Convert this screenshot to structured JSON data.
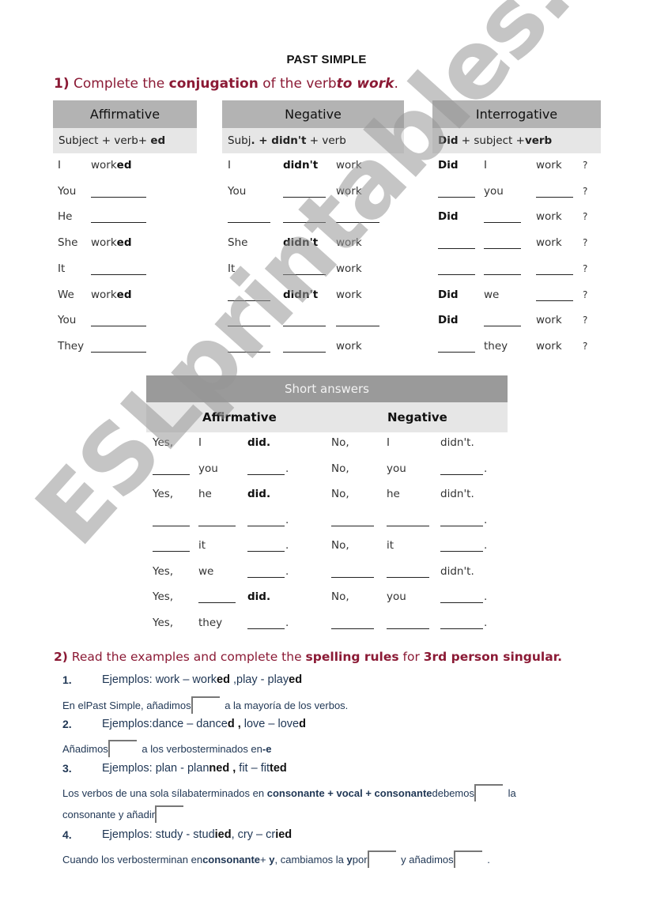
{
  "title": "PAST SIMPLE",
  "exercise1": {
    "number": "1)",
    "pre": "Complete the ",
    "bold": "conjugation",
    "mid": " of the verb",
    "italic": "to work",
    "end": "."
  },
  "tables": {
    "affirmative": {
      "header": "Affirmative",
      "formula_plain": "Subject + verb+ ",
      "formula_bold": "ed",
      "rows": [
        {
          "subject": "I",
          "stem": "work",
          "suffix": "ed",
          "blank": false
        },
        {
          "subject": "You",
          "blank": true
        },
        {
          "subject": "He",
          "blank": true
        },
        {
          "subject": "She",
          "stem": "work",
          "suffix": "ed",
          "blank": false
        },
        {
          "subject": "It",
          "blank": true
        },
        {
          "subject": "We",
          "stem": "work",
          "suffix": "ed",
          "blank": false
        },
        {
          "subject": "You",
          "blank": true
        },
        {
          "subject": "They",
          "blank": true
        }
      ]
    },
    "negative": {
      "header": "Negative",
      "formula_a": "Subj",
      "formula_b": ". + ",
      "formula_bold": "didn't",
      "formula_c": " + verb",
      "rows": [
        [
          "I",
          "didn't",
          "work"
        ],
        [
          "You",
          "",
          "work"
        ],
        [
          "",
          "",
          ""
        ],
        [
          "She",
          "didn't",
          "work"
        ],
        [
          "It",
          "",
          "work"
        ],
        [
          "",
          "didn't",
          "work"
        ],
        [
          "",
          "",
          ""
        ],
        [
          "",
          "",
          "work"
        ]
      ]
    },
    "interrogative": {
      "header": "Interrogative",
      "formula_bold1": "Did",
      "formula_plain": " + subject +",
      "formula_bold2": "verb",
      "question_mark": "?",
      "rows": [
        [
          "Did",
          "I",
          "work"
        ],
        [
          "",
          "you",
          ""
        ],
        [
          "Did",
          "",
          "work"
        ],
        [
          "",
          "",
          "work"
        ],
        [
          "",
          "",
          ""
        ],
        [
          "Did",
          "we",
          ""
        ],
        [
          "Did",
          "",
          "work"
        ],
        [
          "",
          "they",
          "work"
        ]
      ]
    }
  },
  "short_answers": {
    "header": "Short answers",
    "affirmative_label": "Affirmative",
    "negative_label": "Negative",
    "rows": [
      {
        "aff": [
          "Yes,",
          "I",
          "did."
        ],
        "neg": [
          "No,",
          "I",
          "didn't."
        ]
      },
      {
        "aff": [
          "",
          "you",
          ""
        ],
        "neg": [
          "No,",
          "you",
          ""
        ]
      },
      {
        "aff": [
          "Yes,",
          "he",
          "did."
        ],
        "neg": [
          "No,",
          "he",
          "didn't."
        ]
      },
      {
        "aff": [
          "",
          "",
          ""
        ],
        "neg": [
          "",
          "",
          ""
        ]
      },
      {
        "aff": [
          "",
          "it",
          ""
        ],
        "neg": [
          "No,",
          "it",
          ""
        ]
      },
      {
        "aff": [
          "Yes,",
          "we",
          ""
        ],
        "neg": [
          "",
          "",
          "didn't."
        ]
      },
      {
        "aff": [
          "Yes,",
          "",
          "did."
        ],
        "neg": [
          "No,",
          "you",
          ""
        ]
      },
      {
        "aff": [
          "Yes,",
          "they",
          ""
        ],
        "neg": [
          "",
          "",
          ""
        ]
      }
    ]
  },
  "exercise2": {
    "number": "2)",
    "pre": " Read the examples and complete the ",
    "bold1": "spelling rules",
    "mid": " for ",
    "bold2": "3rd person singular.",
    "items": [
      {
        "num": "1.",
        "example_parts": [
          [
            "Ejemplos: work – work",
            false
          ],
          [
            "ed",
            true
          ],
          [
            " ,play - play",
            false
          ],
          [
            "ed",
            true
          ]
        ],
        "rule_parts": [
          [
            "En elPast Simple, añadimos",
            false
          ],
          [
            "[gap]",
            false
          ],
          [
            " a la mayoría de los verbos.",
            false
          ]
        ]
      },
      {
        "num": "2.",
        "example_parts": [
          [
            "Ejemplos:dance – dance",
            false
          ],
          [
            "d",
            true
          ],
          [
            " , ",
            true
          ],
          [
            "love – love",
            false
          ],
          [
            "d",
            true
          ]
        ],
        "rule_parts": [
          [
            "Añadimos",
            false
          ],
          [
            "[gap]",
            false
          ],
          [
            " a los verbosterminados en",
            false
          ],
          [
            "-e",
            true
          ]
        ]
      },
      {
        "num": "3.",
        "example_parts": [
          [
            "Ejemplos: plan - plan",
            false
          ],
          [
            "ned , ",
            true
          ],
          [
            "fit – fit",
            false
          ],
          [
            "ted",
            true
          ]
        ],
        "rule_parts": [
          [
            "Los verbos de una sola sílabaterminados en ",
            false
          ],
          [
            "consonante + vocal + consonante",
            true
          ],
          [
            "debemos",
            false
          ],
          [
            "[gap]",
            false
          ],
          [
            " la",
            false
          ]
        ],
        "rule_parts_2": [
          [
            "consonante y añadir",
            false
          ],
          [
            "[gap]",
            false
          ]
        ]
      },
      {
        "num": "4.",
        "example_parts": [
          [
            "Ejemplos: study - stud",
            false
          ],
          [
            "ied",
            true
          ],
          [
            ", cry – cr",
            false
          ],
          [
            "ied",
            true
          ]
        ],
        "rule_parts": [
          [
            "Cuando los verbosterminan en",
            false
          ],
          [
            "consonante",
            true
          ],
          [
            "+ ",
            false
          ],
          [
            "y",
            true
          ],
          [
            ", cambiamos la ",
            false
          ],
          [
            "y",
            true
          ],
          [
            "por",
            false
          ],
          [
            "[gap]",
            false
          ],
          [
            " y añadimos",
            false
          ],
          [
            "[gap]",
            false
          ],
          [
            " .",
            false
          ]
        ]
      }
    ]
  },
  "watermark": "ESLprintables.com",
  "colors": {
    "accent": "#8b1a35",
    "header_gray": "#b3b3b3",
    "subheader_gray": "#e6e6e6",
    "short_answers_header": "#9a9a9a",
    "rule_text": "#1f3654"
  }
}
